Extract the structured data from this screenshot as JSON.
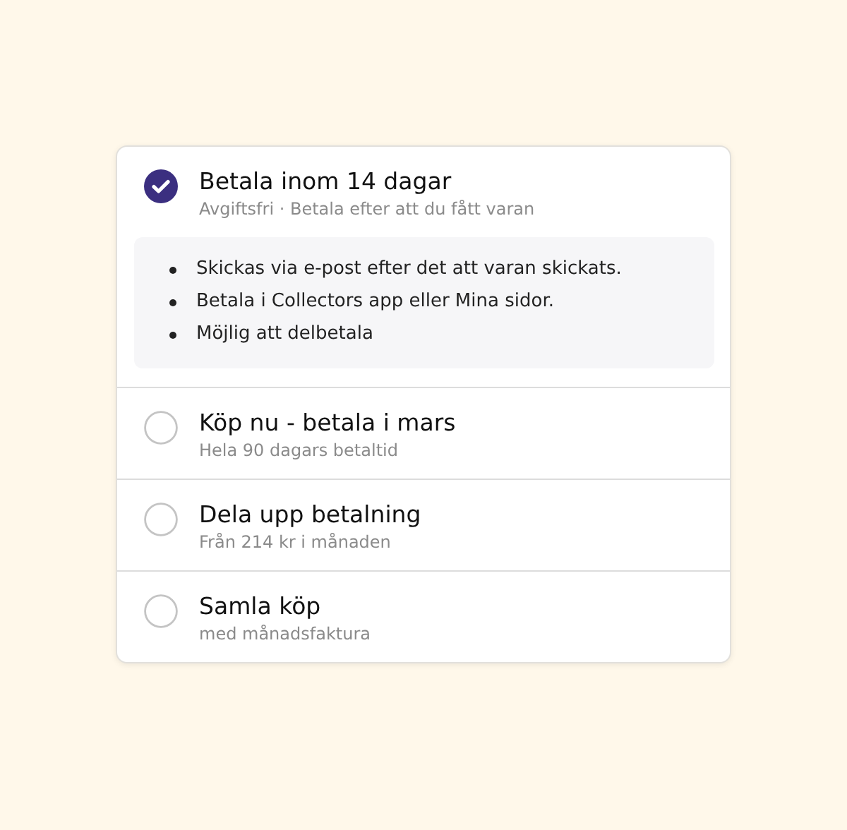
{
  "options": [
    {
      "title": "Betala inom 14 dagar",
      "subtitle": "Avgiftsfri · Betala efter att du fått varan",
      "selected": true,
      "details": [
        "Skickas via e-post efter det att varan skickats.",
        "Betala i Collectors app eller Mina sidor.",
        "Möjlig att delbetala"
      ]
    },
    {
      "title": "Köp nu - betala i mars",
      "subtitle": "Hela 90 dagars betaltid",
      "selected": false
    },
    {
      "title": "Dela upp betalning",
      "subtitle": "Från 214 kr i månaden",
      "selected": false
    },
    {
      "title": "Samla köp",
      "subtitle": "med månadsfaktura",
      "selected": false
    }
  ]
}
